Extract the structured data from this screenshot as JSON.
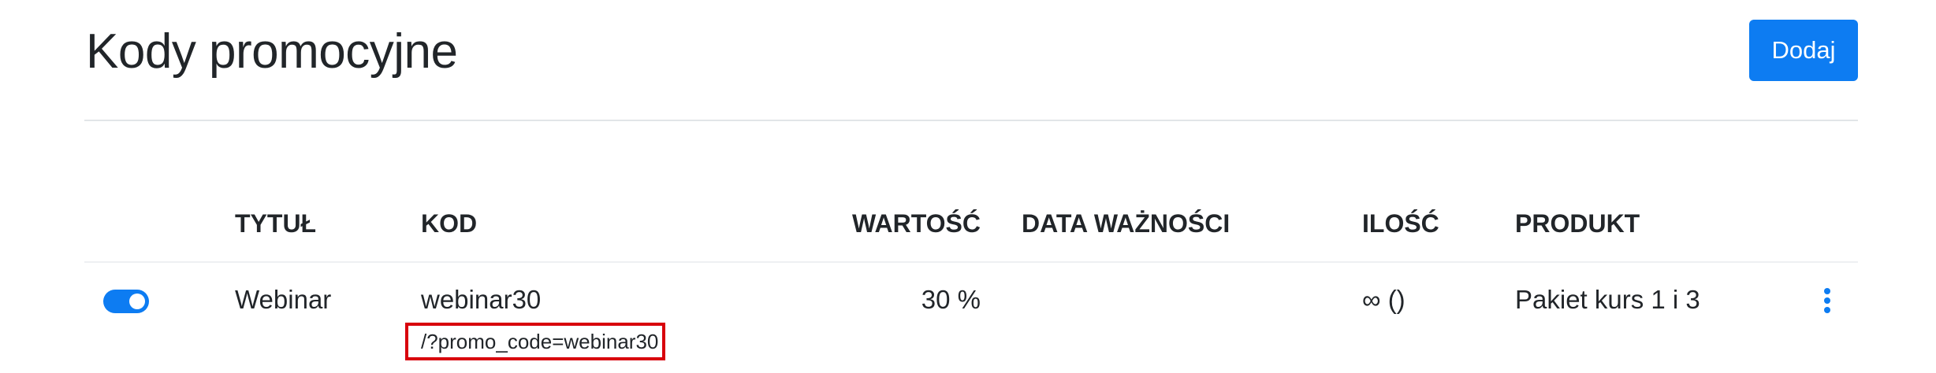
{
  "header": {
    "title": "Kody promocyjne",
    "add_label": "Dodaj"
  },
  "table": {
    "columns": {
      "title": "TYTUŁ",
      "code": "KOD",
      "value": "WARTOŚĆ",
      "expiry": "DATA WAŻNOŚCI",
      "quantity": "ILOŚĆ",
      "product": "PRODUKT"
    },
    "rows": [
      {
        "active": true,
        "title": "Webinar",
        "code": "webinar30",
        "link": "/?promo_code=webinar30",
        "value": "30 %",
        "expiry": "",
        "quantity": "∞ ()",
        "product": "Pakiet kurs 1 i 3"
      }
    ]
  },
  "colors": {
    "accent": "#0d7cf2",
    "highlight": "#d8000c"
  },
  "icons": {
    "row_menu": "vertical-dots-icon"
  }
}
